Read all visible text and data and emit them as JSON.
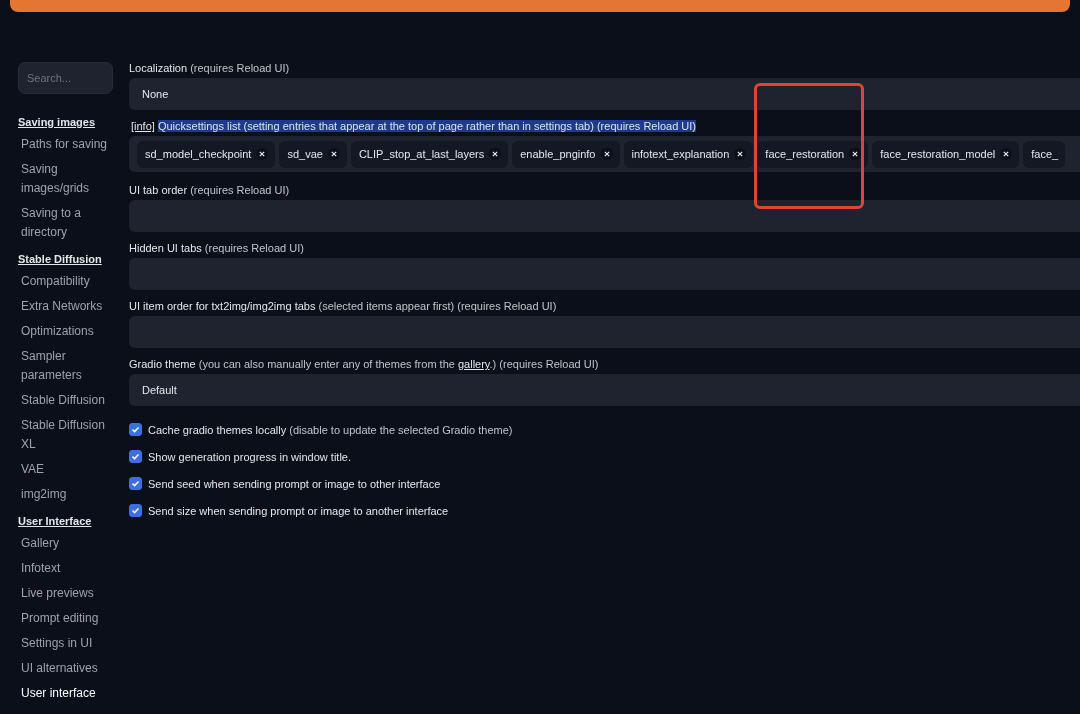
{
  "search": {
    "placeholder": "Search..."
  },
  "sidebar": [
    {
      "heading": "Saving images",
      "items": [
        {
          "label": "Paths for saving",
          "selected": false
        },
        {
          "label": "Saving images/grids",
          "selected": false
        },
        {
          "label": "Saving to a directory",
          "selected": false
        }
      ]
    },
    {
      "heading": "Stable Diffusion",
      "items": [
        {
          "label": "Compatibility",
          "selected": false
        },
        {
          "label": "Extra Networks",
          "selected": false
        },
        {
          "label": "Optimizations",
          "selected": false
        },
        {
          "label": "Sampler parameters",
          "selected": false
        },
        {
          "label": "Stable Diffusion",
          "selected": false
        },
        {
          "label": "Stable Diffusion XL",
          "selected": false
        },
        {
          "label": "VAE",
          "selected": false
        },
        {
          "label": "img2img",
          "selected": false
        }
      ]
    },
    {
      "heading": "User Interface",
      "items": [
        {
          "label": "Gallery",
          "selected": false
        },
        {
          "label": "Infotext",
          "selected": false
        },
        {
          "label": "Live previews",
          "selected": false
        },
        {
          "label": "Prompt editing",
          "selected": false
        },
        {
          "label": "Settings in UI",
          "selected": false
        },
        {
          "label": "UI alternatives",
          "selected": false
        },
        {
          "label": "User interface",
          "selected": true
        }
      ]
    }
  ],
  "settings": [
    {
      "kind": "dropdown",
      "label": "Localization",
      "note": "(requires Reload UI)",
      "value": "None"
    },
    {
      "kind": "tags",
      "info": "[info]",
      "label": "Quicksettings list",
      "note": "(setting entries that appear at the top of page rather than in settings tab) (requires Reload UI)",
      "tags": [
        {
          "label": "sd_model_checkpoint",
          "removable": true
        },
        {
          "label": "sd_vae",
          "removable": true
        },
        {
          "label": "CLIP_stop_at_last_layers",
          "removable": true
        },
        {
          "label": "enable_pnginfo",
          "removable": true
        },
        {
          "label": "infotext_explanation",
          "removable": true
        },
        {
          "label": "face_restoration",
          "removable": true
        },
        {
          "label": "face_restoration_model",
          "removable": true
        },
        {
          "label": "face_",
          "removable": false
        }
      ]
    },
    {
      "kind": "dropdown",
      "label": "UI tab order",
      "note": "(requires Reload UI)"
    },
    {
      "kind": "dropdown",
      "label": "Hidden UI tabs",
      "note": "(requires Reload UI)"
    },
    {
      "kind": "dropdown",
      "label": "UI item order for txt2img/img2img tabs",
      "note": "(selected items appear first) (requires Reload UI)"
    },
    {
      "kind": "dropdown",
      "label": "Gradio theme",
      "note": "(you can also manually enter any of themes from the",
      "link": "gallery",
      "note_after": ".) (requires Reload UI)",
      "value": "Default"
    },
    {
      "kind": "checkbox",
      "label": "Cache gradio themes locally",
      "note": "(disable to update the selected Gradio theme)",
      "checked": true
    },
    {
      "kind": "checkbox",
      "label": "Show generation progress in window title.",
      "checked": true
    },
    {
      "kind": "checkbox",
      "label": "Send seed when sending prompt or image to other interface",
      "checked": true
    },
    {
      "kind": "checkbox",
      "label": "Send size when sending prompt or image to another interface",
      "checked": true
    }
  ]
}
